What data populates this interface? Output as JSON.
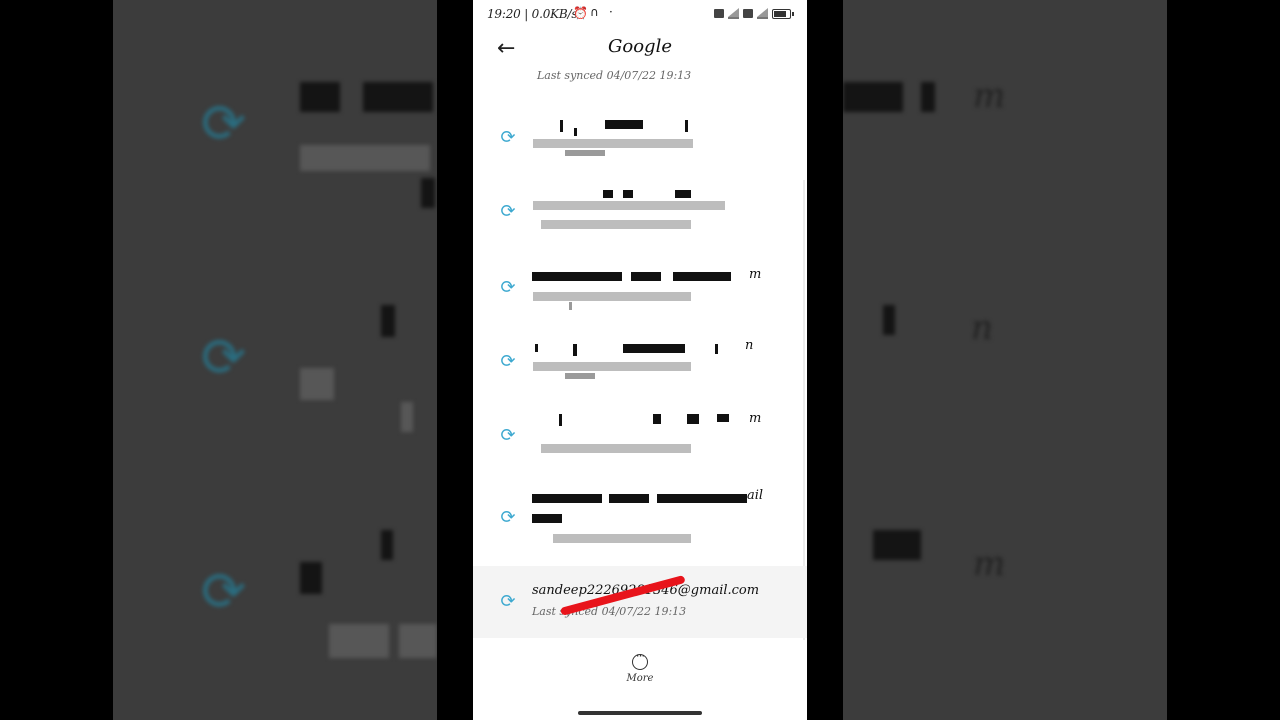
{
  "status_bar": {
    "time_speed": "19:20 | 0.0KB/s",
    "battery_level": 0.8
  },
  "app_bar": {
    "title": "Google"
  },
  "list": {
    "partial_top_subtitle": "Last synced 04/07/22 19:13",
    "items": [
      {
        "visible_tail": ""
      },
      {
        "visible_tail": ""
      },
      {
        "visible_tail": "m"
      },
      {
        "visible_tail": "n"
      },
      {
        "visible_tail": "m"
      },
      {
        "visible_tail": "ail"
      },
      {
        "account": "sandeep22269281346@gmail.com",
        "subtitle": "Last synced 04/07/22 19:13"
      }
    ]
  },
  "footer": {
    "more_label": "More"
  },
  "background_copy": {
    "text_fragments": [
      "m",
      "n",
      "m"
    ]
  },
  "colors": {
    "sync_icon": "#3ea9d0",
    "annotation_stroke": "#e8141b"
  },
  "icons": {
    "back": "arrow-left",
    "sync": "sync-arrows",
    "more": "more-circle"
  }
}
